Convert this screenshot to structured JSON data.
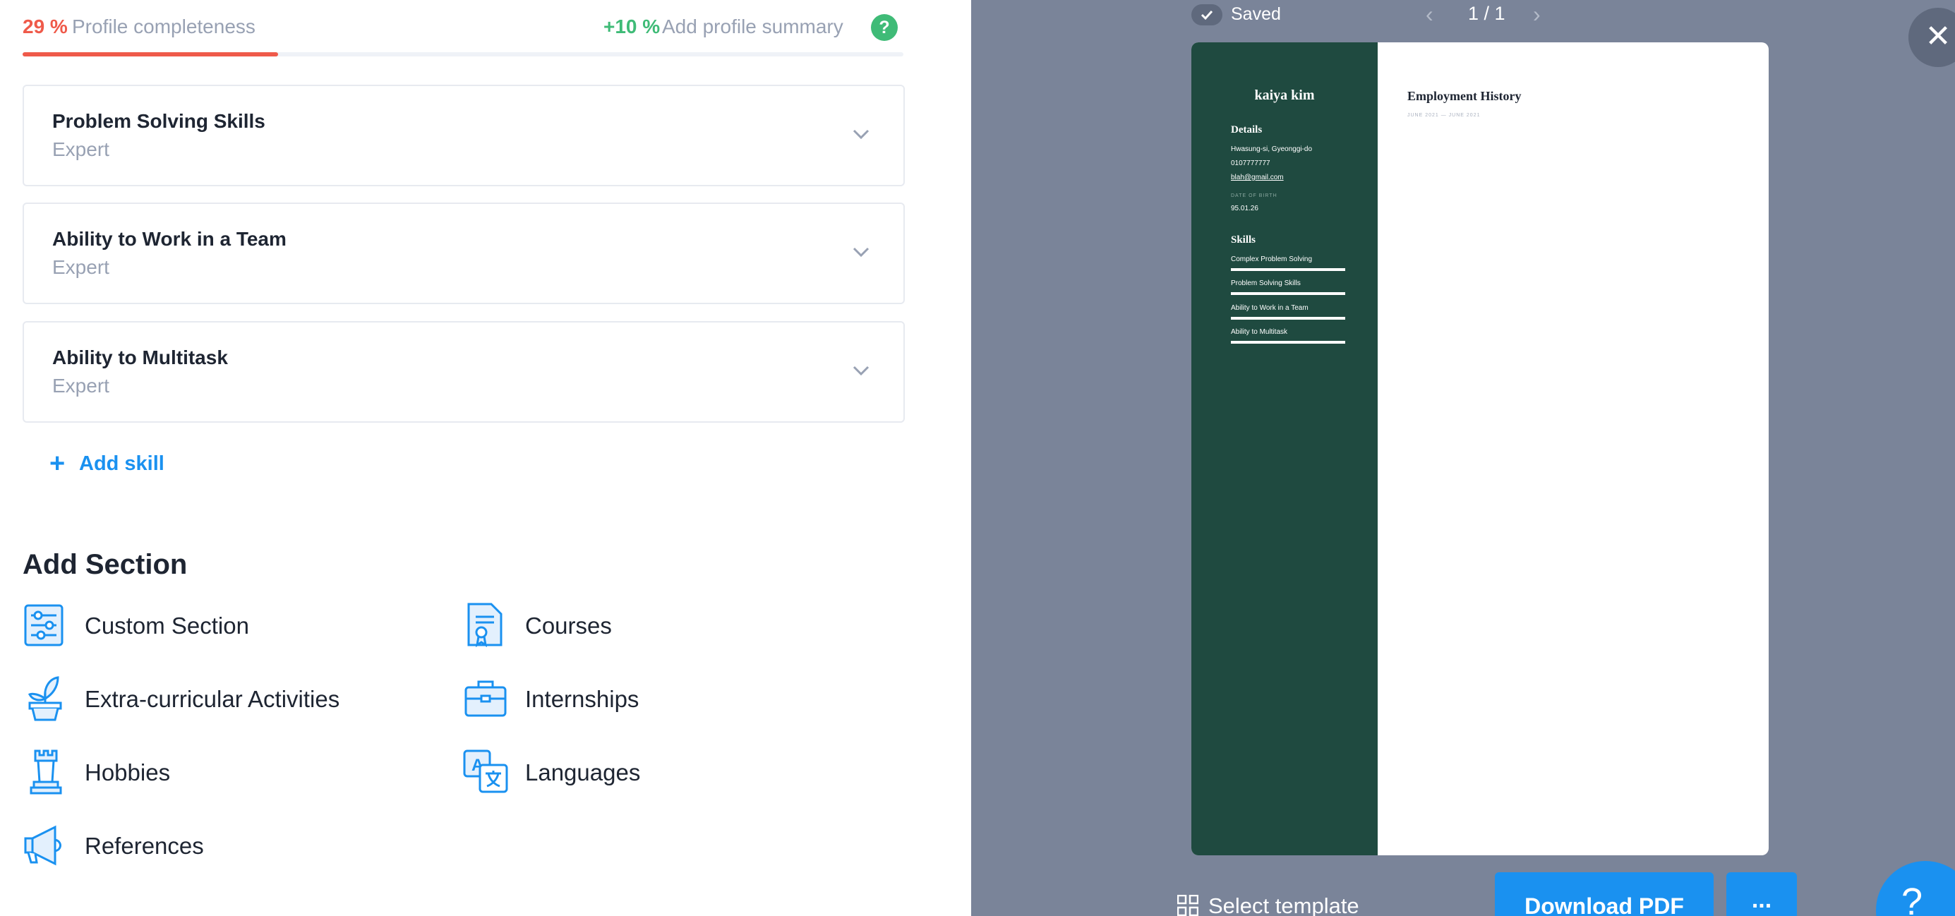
{
  "completeness": {
    "percent_text": "29 %",
    "label": "Profile completeness",
    "progress_fraction": 0.29,
    "bonus": "+10 %",
    "hint": "Add profile summary",
    "help_symbol": "?"
  },
  "skills": [
    {
      "title": "Problem Solving Skills",
      "level": "Expert"
    },
    {
      "title": "Ability to Work in a Team",
      "level": "Expert"
    },
    {
      "title": "Ability to Multitask",
      "level": "Expert"
    }
  ],
  "add_skill": {
    "icon": "+",
    "label": "Add skill"
  },
  "add_section": {
    "title": "Add Section",
    "items": [
      {
        "label": "Custom Section",
        "icon": "sliders-icon"
      },
      {
        "label": "Courses",
        "icon": "certificate-icon"
      },
      {
        "label": "Extra-curricular Activities",
        "icon": "plant-icon"
      },
      {
        "label": "Internships",
        "icon": "briefcase-icon"
      },
      {
        "label": "Hobbies",
        "icon": "chess-rook-icon"
      },
      {
        "label": "Languages",
        "icon": "translate-icon"
      },
      {
        "label": "References",
        "icon": "megaphone-icon"
      }
    ]
  },
  "preview": {
    "saved": "Saved",
    "page_indicator": "1 / 1",
    "prev_arrow": "‹",
    "next_arrow": "›",
    "close_symbol": "✕",
    "select_template": "Select template",
    "download": "Download PDF",
    "more": "...",
    "help_symbol": "?"
  },
  "resume": {
    "name": "kaiya kim",
    "details_heading": "Details",
    "address": "Hwasung-si, Gyeonggi-do",
    "phone": "0107777777",
    "email": "blah@gmail.com",
    "dob_label": "DATE OF BIRTH",
    "dob": "95.01.26",
    "skills_heading": "Skills",
    "skills": [
      "Complex Problem Solving",
      "Problem Solving Skills",
      "Ability to Work in a Team",
      "Ability to Multitask"
    ],
    "employment_heading": "Employment History",
    "employment_dates": "JUNE 2021 — JUNE 2021"
  },
  "colors": {
    "accent": "#1a91f0",
    "danger": "#ef5a4a",
    "success": "#3fbb77",
    "resume_sidebar": "#1f4a40",
    "preview_bg": "#7a8499"
  }
}
